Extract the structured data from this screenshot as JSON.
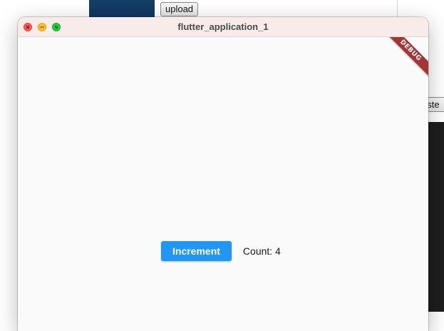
{
  "background": {
    "upload_button_label": "upload",
    "paste_button_label": "aste"
  },
  "window": {
    "title": "flutter_application_1"
  },
  "debug_banner": {
    "label": "DEBUG"
  },
  "main": {
    "increment_button_label": "Increment",
    "count_label": "Count: 4"
  },
  "colors": {
    "accent": "#2196f3",
    "debug_ribbon": "#a33535",
    "title_bar": "#f7ecea",
    "content_background": "#fafafa"
  },
  "icons": {
    "close": "close-icon",
    "minimize": "minimize-icon",
    "maximize": "maximize-icon"
  }
}
